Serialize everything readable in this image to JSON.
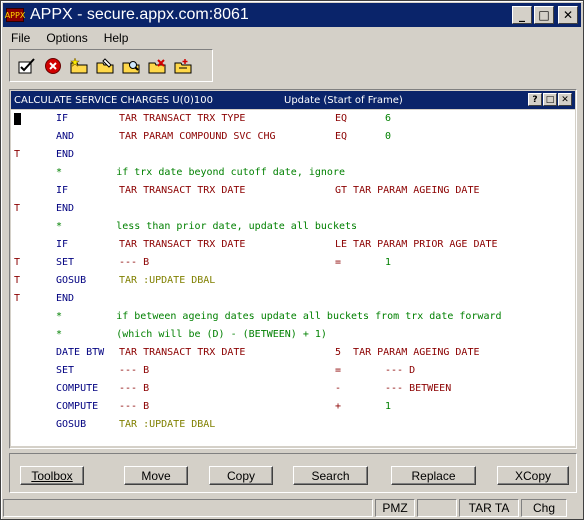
{
  "window": {
    "title": "APPX - secure.appx.com:8061",
    "logo_text": "APPX",
    "minimize_glyph": "_",
    "maximize_glyph": "□",
    "close_glyph": "✕"
  },
  "menubar": {
    "items": [
      "File",
      "Options",
      "Help"
    ]
  },
  "toolbar": {
    "tools": [
      {
        "icon": "checkmark-icon"
      },
      {
        "icon": "cancel-icon"
      },
      {
        "icon": "add-record-icon"
      },
      {
        "icon": "change-record-icon"
      },
      {
        "icon": "inquire-record-icon"
      },
      {
        "icon": "delete-record-icon"
      },
      {
        "icon": "scan-record-icon"
      }
    ]
  },
  "frame": {
    "title_left": "CALCULATE SERVICE CHARGES U(0)100",
    "title_mid": "Update  (Start of Frame)",
    "help_glyph": "?",
    "restore_glyph": "□",
    "close_glyph": "✕"
  },
  "code_lines": [
    {
      "t": "",
      "cursor": true,
      "verb": "IF",
      "f1": "TAR TRANSACT TRX TYPE",
      "op": "EQ",
      "f2": "6",
      "f2type": "lit"
    },
    {
      "t": "",
      "verb": "AND",
      "f1": "TAR PARAM COMPOUND SVC CHG",
      "op": "EQ",
      "f2": "0",
      "f2type": "lit"
    },
    {
      "t": "T",
      "verb": "END",
      "f1": "",
      "op": "",
      "f2": ""
    },
    {
      "t": "",
      "comment": "*         if trx date beyond cutoff date, ignore"
    },
    {
      "t": "",
      "verb": "IF",
      "f1": "TAR TRANSACT TRX DATE",
      "op": "GT TAR PARAM AGEING DATE",
      "f2": ""
    },
    {
      "t": "T",
      "verb": "END",
      "f1": "",
      "op": "",
      "f2": ""
    },
    {
      "t": "",
      "comment": "*         less than prior date, update all buckets"
    },
    {
      "t": "",
      "verb": "IF",
      "f1": "TAR TRANSACT TRX DATE",
      "op": "LE TAR PARAM PRIOR AGE DATE",
      "f2": ""
    },
    {
      "t": "T",
      "verb": "SET",
      "f1": "--- B",
      "op": "=",
      "f2": "1",
      "f2type": "lit"
    },
    {
      "t": "T",
      "verb": "GOSUB",
      "f1": "TAR :UPDATE DBAL",
      "f1type": "gosub",
      "op": "",
      "f2": ""
    },
    {
      "t": "T",
      "verb": "END",
      "f1": "",
      "op": "",
      "f2": ""
    },
    {
      "t": "",
      "comment": "*         if between ageing dates update all buckets from trx date forward"
    },
    {
      "t": "",
      "comment": "*         (which will be (D) - (BETWEEN) + 1)"
    },
    {
      "t": "",
      "verb": "DATE BTW",
      "f1": "TAR TRANSACT TRX DATE",
      "op": "5  TAR PARAM AGEING DATE",
      "f2": ""
    },
    {
      "t": "",
      "verb": "SET",
      "f1": "--- B",
      "op": "=",
      "f2": "--- D",
      "f2type": "field"
    },
    {
      "t": "",
      "verb": "COMPUTE",
      "f1": "--- B",
      "op": "-",
      "f2": "--- BETWEEN",
      "f2type": "field"
    },
    {
      "t": "",
      "verb": "COMPUTE",
      "f1": "--- B",
      "op": "+",
      "f2": "1",
      "f2type": "lit"
    },
    {
      "t": "",
      "verb": "GOSUB",
      "f1": "TAR :UPDATE DBAL",
      "f1type": "gosub",
      "op": "",
      "f2": ""
    }
  ],
  "buttons": [
    {
      "label": "Toolbox",
      "name": "toolbox-button"
    },
    {
      "label": "Move",
      "name": "move-button"
    },
    {
      "label": "Copy",
      "name": "copy-button"
    },
    {
      "label": "Search",
      "name": "search-button"
    },
    {
      "label": "Replace",
      "name": "replace-button"
    },
    {
      "label": "XCopy",
      "name": "xcopy-button"
    }
  ],
  "statusbar": {
    "cells": [
      "",
      "PMZ",
      "",
      "TAR TA",
      "Chg"
    ]
  },
  "colors": {
    "titlebar": "#0a246a",
    "verb": "#000080",
    "field": "#8b0000",
    "comment": "#008000",
    "gosub_target": "#808000"
  }
}
